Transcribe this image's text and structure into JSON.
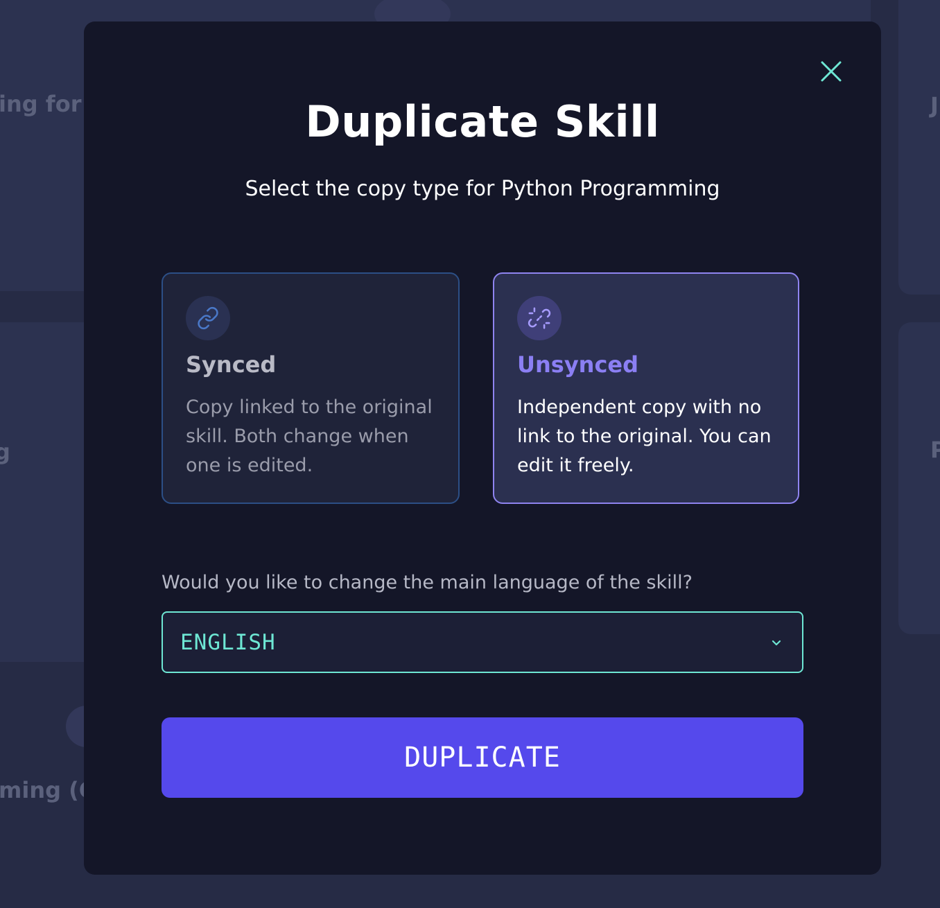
{
  "background": {
    "texts": [
      "ing for r",
      "g",
      "ming (C",
      "J",
      "P"
    ]
  },
  "modal": {
    "title": "Duplicate Skill",
    "subtitle": "Select the copy type for Python Programming",
    "close_icon": "close-icon",
    "options": [
      {
        "id": "synced",
        "icon": "link-icon",
        "title": "Synced",
        "description": "Copy linked to the original skill. Both change when one is edited.",
        "selected": false
      },
      {
        "id": "unsynced",
        "icon": "unlink-icon",
        "title": "Unsynced",
        "description": "Independent copy with no link to the original. You can edit it freely.",
        "selected": true
      }
    ],
    "language": {
      "question": "Would you like to change the main language of the skill?",
      "selected": "ENGLISH",
      "icon": "chevron-down-icon"
    },
    "action": {
      "label": "DUPLICATE"
    }
  },
  "colors": {
    "modal_bg": "#141628",
    "accent_teal": "#6ee7d4",
    "accent_purple": "#8b7ff3",
    "button_bg": "#5549ec",
    "synced_border": "#2c4f86",
    "unsynced_border": "#8f84f0"
  }
}
